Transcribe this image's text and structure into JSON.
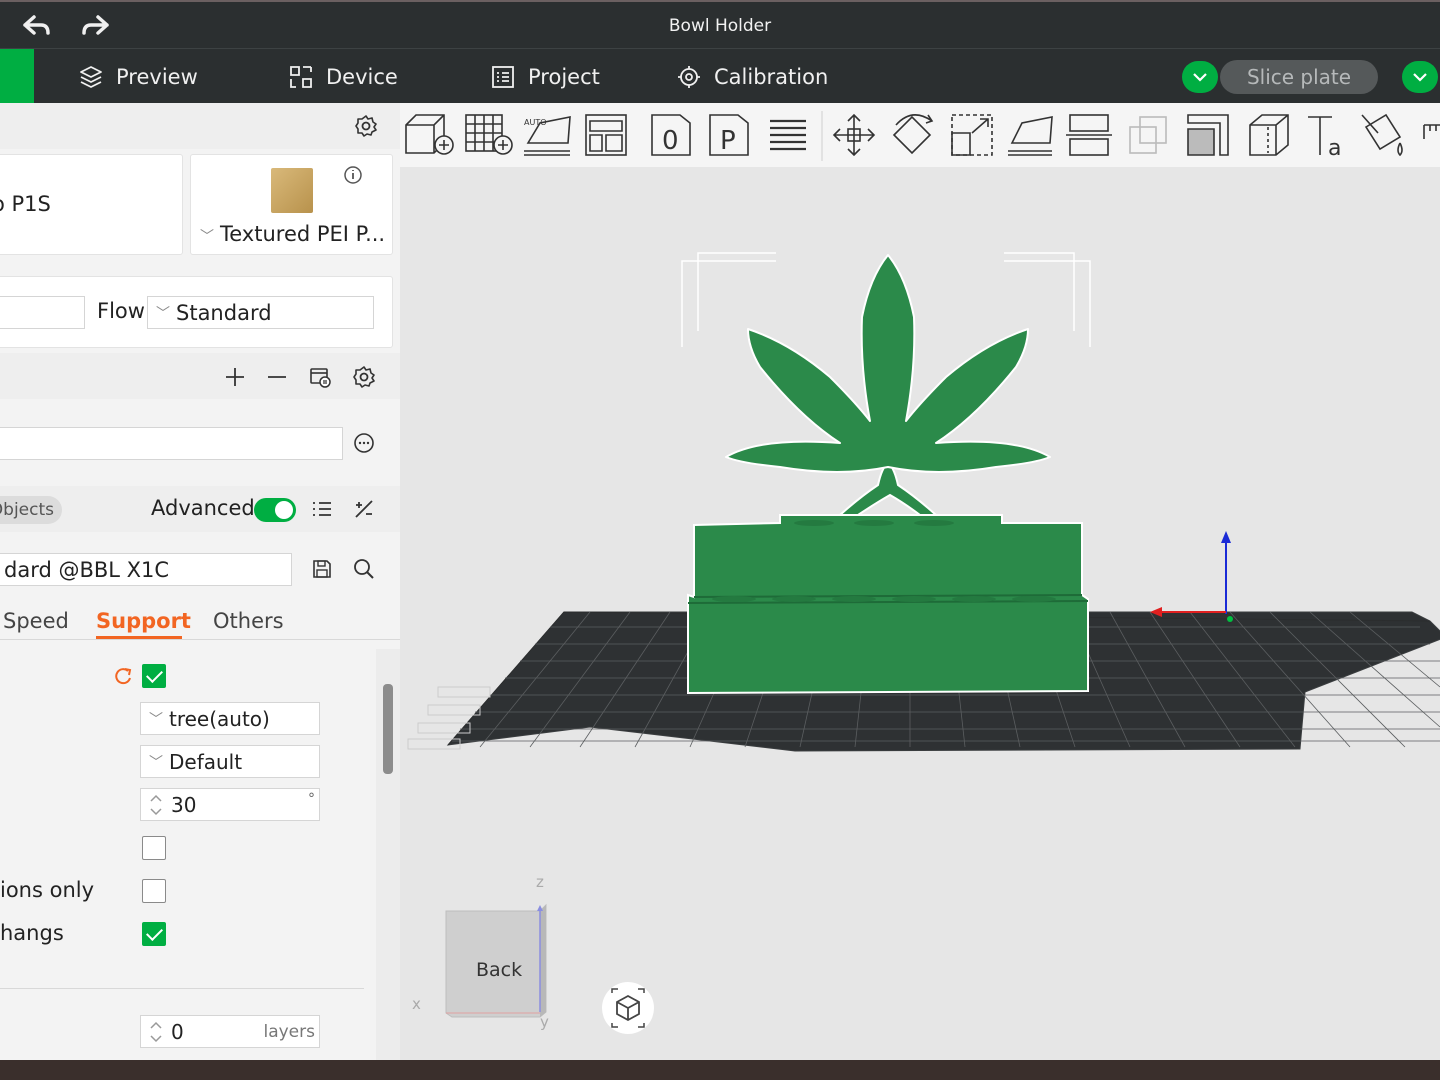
{
  "window": {
    "title": "Bowl Holder"
  },
  "nav": {
    "preview": "Preview",
    "device": "Device",
    "project": "Project",
    "calibration": "Calibration",
    "slice_plate": "Slice plate"
  },
  "printer": {
    "name_partial": "o P1S"
  },
  "plate": {
    "type": "Textured PEI P..."
  },
  "filament": {
    "flow_label": "Flow",
    "flow_value": "Standard"
  },
  "objects": {
    "tab_label": "Objects",
    "advanced_label": "Advanced",
    "advanced_on": true
  },
  "process": {
    "preset": "dard @BBL X1C"
  },
  "tabs": [
    {
      "label": "Speed",
      "active": false
    },
    {
      "label": "Support",
      "active": true
    },
    {
      "label": "Others",
      "active": false
    }
  ],
  "support": {
    "enable": true,
    "type": "tree(auto)",
    "style": "Default",
    "threshold_angle": "30",
    "threshold_unit": "°",
    "option_4": false,
    "option_5_label": "ions only",
    "option_5": false,
    "option_6_label": "hangs",
    "option_6": true,
    "raft_layers": "0",
    "raft_unit": "layers"
  },
  "viewport": {
    "view_cube_label": "Back",
    "axis_x": "x",
    "axis_y": "y",
    "axis_z": "z"
  },
  "colors": {
    "accent": "#00ae42",
    "active_tab": "#f26522",
    "model": "#2b8a4a",
    "plate": "#2e3133"
  }
}
